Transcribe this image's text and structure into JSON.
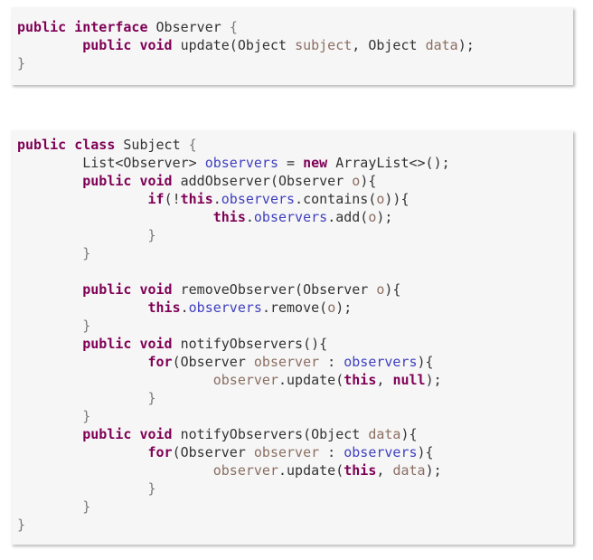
{
  "code_blocks": [
    {
      "lines": [
        [
          [
            "kw",
            "public"
          ],
          [
            "t",
            " "
          ],
          [
            "kw",
            "interface"
          ],
          [
            "t",
            " Observer "
          ],
          [
            "br",
            "{"
          ]
        ],
        [
          [
            "t",
            "        "
          ],
          [
            "kw",
            "public"
          ],
          [
            "t",
            " "
          ],
          [
            "kw",
            "void"
          ],
          [
            "t",
            " update(Object "
          ],
          [
            "prm",
            "subject"
          ],
          [
            "t",
            ", Object "
          ],
          [
            "prm",
            "data"
          ],
          [
            "t",
            ");"
          ]
        ],
        [
          [
            "br",
            "}"
          ]
        ]
      ]
    },
    {
      "lines": [
        [
          [
            "kw",
            "public"
          ],
          [
            "t",
            " "
          ],
          [
            "kw",
            "class"
          ],
          [
            "t",
            " Subject "
          ],
          [
            "br",
            "{"
          ]
        ],
        [
          [
            "t",
            "        List<Observer> "
          ],
          [
            "fld",
            "observers"
          ],
          [
            "t",
            " = "
          ],
          [
            "kw",
            "new"
          ],
          [
            "t",
            " ArrayList<>();"
          ]
        ],
        [
          [
            "t",
            "        "
          ],
          [
            "kw",
            "public"
          ],
          [
            "t",
            " "
          ],
          [
            "kw",
            "void"
          ],
          [
            "t",
            " addObserver(Observer "
          ],
          [
            "prm",
            "o"
          ],
          [
            "t",
            "){"
          ]
        ],
        [
          [
            "t",
            "                "
          ],
          [
            "kw",
            "if"
          ],
          [
            "t",
            "(!"
          ],
          [
            "kw",
            "this"
          ],
          [
            "t",
            "."
          ],
          [
            "fld",
            "observers"
          ],
          [
            "t",
            ".contains("
          ],
          [
            "prm",
            "o"
          ],
          [
            "t",
            ")){"
          ]
        ],
        [
          [
            "t",
            "                        "
          ],
          [
            "kw",
            "this"
          ],
          [
            "t",
            "."
          ],
          [
            "fld",
            "observers"
          ],
          [
            "t",
            ".add("
          ],
          [
            "prm",
            "o"
          ],
          [
            "t",
            ");"
          ]
        ],
        [
          [
            "t",
            "                "
          ],
          [
            "br",
            "}"
          ]
        ],
        [
          [
            "t",
            "        "
          ],
          [
            "br",
            "}"
          ]
        ],
        [
          [
            "t",
            ""
          ]
        ],
        [
          [
            "t",
            "        "
          ],
          [
            "kw",
            "public"
          ],
          [
            "t",
            " "
          ],
          [
            "kw",
            "void"
          ],
          [
            "t",
            " removeObserver(Observer "
          ],
          [
            "prm",
            "o"
          ],
          [
            "t",
            "){"
          ]
        ],
        [
          [
            "t",
            "                "
          ],
          [
            "kw",
            "this"
          ],
          [
            "t",
            "."
          ],
          [
            "fld",
            "observers"
          ],
          [
            "t",
            ".remove("
          ],
          [
            "prm",
            "o"
          ],
          [
            "t",
            ");"
          ]
        ],
        [
          [
            "t",
            "        "
          ],
          [
            "br",
            "}"
          ]
        ],
        [
          [
            "t",
            "        "
          ],
          [
            "kw",
            "public"
          ],
          [
            "t",
            " "
          ],
          [
            "kw",
            "void"
          ],
          [
            "t",
            " notifyObservers(){"
          ]
        ],
        [
          [
            "t",
            "                "
          ],
          [
            "kw",
            "for"
          ],
          [
            "t",
            "(Observer "
          ],
          [
            "prm",
            "observer"
          ],
          [
            "t",
            " : "
          ],
          [
            "fld",
            "observers"
          ],
          [
            "t",
            "){"
          ]
        ],
        [
          [
            "t",
            "                        "
          ],
          [
            "prm",
            "observer"
          ],
          [
            "t",
            ".update("
          ],
          [
            "kw",
            "this"
          ],
          [
            "t",
            ", "
          ],
          [
            "kw",
            "null"
          ],
          [
            "t",
            ");"
          ]
        ],
        [
          [
            "t",
            "                "
          ],
          [
            "br",
            "}"
          ]
        ],
        [
          [
            "t",
            "        "
          ],
          [
            "br",
            "}"
          ]
        ],
        [
          [
            "t",
            "        "
          ],
          [
            "kw",
            "public"
          ],
          [
            "t",
            " "
          ],
          [
            "kw",
            "void"
          ],
          [
            "t",
            " notifyObservers(Object "
          ],
          [
            "prm",
            "data"
          ],
          [
            "t",
            "){"
          ]
        ],
        [
          [
            "t",
            "                "
          ],
          [
            "kw",
            "for"
          ],
          [
            "t",
            "(Observer "
          ],
          [
            "prm",
            "observer"
          ],
          [
            "t",
            " : "
          ],
          [
            "fld",
            "observers"
          ],
          [
            "t",
            "){"
          ]
        ],
        [
          [
            "t",
            "                        "
          ],
          [
            "prm",
            "observer"
          ],
          [
            "t",
            ".update("
          ],
          [
            "kw",
            "this"
          ],
          [
            "t",
            ", "
          ],
          [
            "prm",
            "data"
          ],
          [
            "t",
            ");"
          ]
        ],
        [
          [
            "t",
            "                "
          ],
          [
            "br",
            "}"
          ]
        ],
        [
          [
            "t",
            "        "
          ],
          [
            "br",
            "}"
          ]
        ],
        [
          [
            "br",
            "}"
          ]
        ]
      ]
    }
  ],
  "colors": {
    "keyword": "#7f0055",
    "field": "#3f3fbf",
    "parameter": "#8b6e62",
    "brace": "#777777",
    "text": "#333333",
    "background": "#f6f6f6"
  }
}
